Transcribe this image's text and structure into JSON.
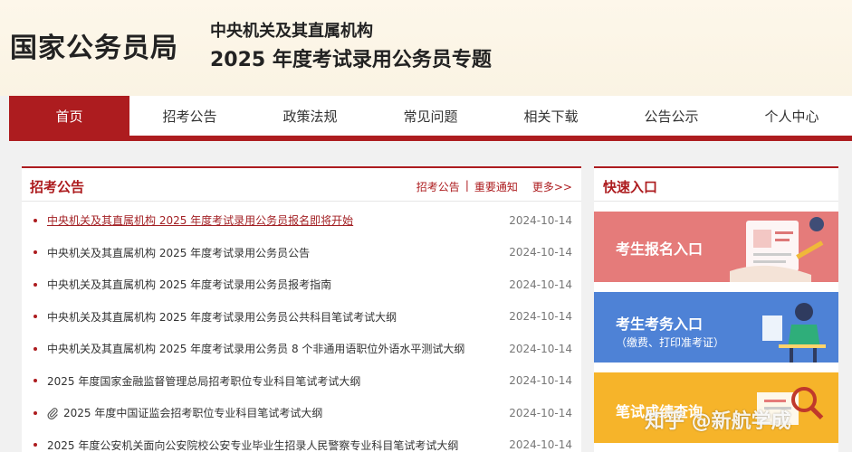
{
  "header": {
    "site_name": "国家公务员局",
    "subtitle_line1": "中央机关及其直属机构",
    "subtitle_line2": "2025 年度考试录用公务员专题"
  },
  "nav": {
    "items": [
      "首页",
      "招考公告",
      "政策法规",
      "常见问题",
      "相关下载",
      "公告公示",
      "个人中心"
    ],
    "active_index": 0
  },
  "announcements": {
    "title": "招考公告",
    "links": [
      "招考公告",
      "|",
      "重要通知"
    ],
    "more": "更多>>",
    "items": [
      {
        "title": "中央机关及其直属机构 2025 年度考试录用公务员报名即将开始",
        "date": "2024-10-14"
      },
      {
        "title": "中央机关及其直属机构 2025 年度考试录用公务员公告",
        "date": "2024-10-14"
      },
      {
        "title": "中央机关及其直属机构 2025 年度考试录用公务员报考指南",
        "date": "2024-10-14"
      },
      {
        "title": "中央机关及其直属机构 2025 年度考试录用公务员公共科目笔试考试大纲",
        "date": "2024-10-14"
      },
      {
        "title": "中央机关及其直属机构 2025 年度考试录用公务员 8 个非通用语职位外语水平测试大纲",
        "date": "2024-10-14"
      },
      {
        "title": "2025 年度国家金融监督管理总局招考职位专业科目笔试考试大纲",
        "date": "2024-10-14"
      },
      {
        "title": "2025 年度中国证监会招考职位专业科目笔试考试大纲",
        "date": "2024-10-14"
      },
      {
        "title": "2025 年度公安机关面向公安院校公安专业毕业生招录人民警察专业科目笔试考试大纲",
        "date": "2024-10-14"
      }
    ]
  },
  "quick_entry": {
    "title": "快速入口",
    "cards": [
      {
        "label": "考生报名入口",
        "sub": ""
      },
      {
        "label": "考生考务入口",
        "sub": "（缴费、打印准考证）"
      },
      {
        "label": "笔试成绩查询",
        "sub": ""
      }
    ]
  },
  "watermark": "知乎 @新航学成",
  "colors": {
    "brand_red": "#ad1c1f",
    "card_red": "#e57b7a",
    "card_blue": "#4e82d6",
    "card_yellow": "#f6b42a"
  }
}
